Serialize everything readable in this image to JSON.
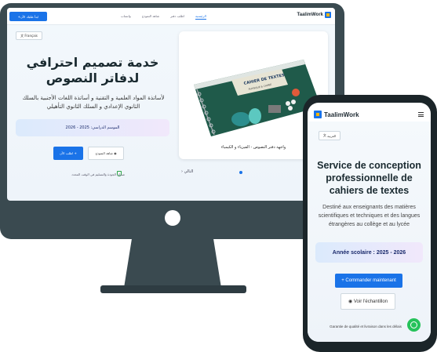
{
  "desktop": {
    "nav": {
      "cta_label": "ابدأ طلبك الآن",
      "links": [
        "واتساب",
        "شاهد النموذج",
        "اطلب دفتر",
        "الرئيسية"
      ],
      "active_link": "الرئيسية",
      "logo_text": "TaalimWork"
    },
    "lang_button": "Français",
    "hero": {
      "title": "خدمة تصميم احترافي لدفاتر النصوص",
      "subtitle": "لأساتذة المواد العلمية و التقنية و أساتذة اللغات الأجنبية بالسلك الثانوي الإعدادي و السلك الثانوي التأهيلي",
      "season": "الموسم الدراسي: 2025 - 2026",
      "order_button": "اطلب الآن",
      "sample_button": "شاهد النموذج",
      "guarantee": "ضمان الجودة والتسليم في الوقت المحدد"
    },
    "product": {
      "cover_title": "CAHIER DE TEXTES",
      "cover_subtitle": "PHYSIQUE & CHIMIE",
      "caption": "واجهة دفتر النصوص - الفيزياء و الكيمياء",
      "next_label": "التالي"
    }
  },
  "mobile": {
    "logo_text": "TaalimWork",
    "lang_button": "العربية",
    "title": "Service de conception professionnelle de cahiers de textes",
    "subtitle": "Destiné aux enseignants des matières scientifiques et techniques et des langues étrangères au collège et au lycée",
    "year": "Année scolaire : 2025 - 2026",
    "order_button": "Commander maintenant",
    "sample_button": "Voir l'échantillon",
    "guarantee": "Garantie de qualité et livraison dans les délais"
  },
  "colors": {
    "accent": "#1a73e8",
    "device_frame": "#3a4a50",
    "whatsapp": "#25c25a",
    "book_cover": "#1f5a4a"
  }
}
